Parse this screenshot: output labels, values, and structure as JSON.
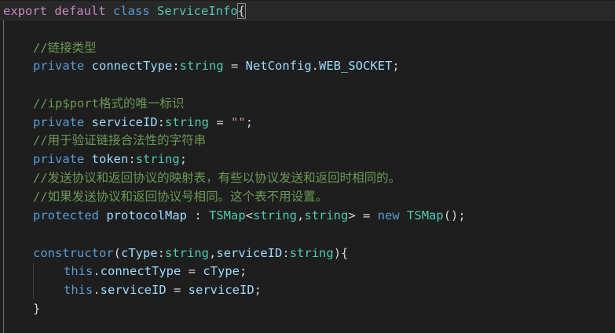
{
  "editor": {
    "theme_colors": {
      "background": "#1e1e1e",
      "keyword": "#569cd6",
      "keyword_control": "#c586c0",
      "type": "#4ec9b0",
      "variable": "#9cdcfe",
      "comment": "#6a9955",
      "string": "#ce9178",
      "plain": "#d4d4d4",
      "function": "#dcdcaa"
    },
    "lines": [
      {
        "tokens": [
          {
            "t": "export",
            "c": "keyword_control"
          },
          {
            "t": " ",
            "c": "plain"
          },
          {
            "t": "default",
            "c": "keyword_control"
          },
          {
            "t": " ",
            "c": "plain"
          },
          {
            "t": "class",
            "c": "keyword"
          },
          {
            "t": " ",
            "c": "plain"
          },
          {
            "t": "ServiceInfo",
            "c": "type"
          },
          {
            "t": "{",
            "c": "plain",
            "bracket": true
          }
        ]
      },
      {
        "tokens": []
      },
      {
        "tokens": [
          {
            "t": "//链接类型",
            "c": "comment"
          }
        ]
      },
      {
        "tokens": [
          {
            "t": "private",
            "c": "keyword"
          },
          {
            "t": " ",
            "c": "plain"
          },
          {
            "t": "connectType",
            "c": "variable"
          },
          {
            "t": ":",
            "c": "plain"
          },
          {
            "t": "string",
            "c": "type"
          },
          {
            "t": " = ",
            "c": "plain"
          },
          {
            "t": "NetConfig",
            "c": "variable"
          },
          {
            "t": ".",
            "c": "plain"
          },
          {
            "t": "WEB_SOCKET",
            "c": "variable"
          },
          {
            "t": ";",
            "c": "plain"
          }
        ]
      },
      {
        "tokens": []
      },
      {
        "tokens": [
          {
            "t": "//ip$port格式的唯一标识",
            "c": "comment"
          }
        ]
      },
      {
        "tokens": [
          {
            "t": "private",
            "c": "keyword"
          },
          {
            "t": " ",
            "c": "plain"
          },
          {
            "t": "serviceID",
            "c": "variable"
          },
          {
            "t": ":",
            "c": "plain"
          },
          {
            "t": "string",
            "c": "type"
          },
          {
            "t": " = ",
            "c": "plain"
          },
          {
            "t": "\"\"",
            "c": "string"
          },
          {
            "t": ";",
            "c": "plain"
          }
        ]
      },
      {
        "tokens": [
          {
            "t": "//用于验证链接合法性的字符串",
            "c": "comment"
          }
        ]
      },
      {
        "tokens": [
          {
            "t": "private",
            "c": "keyword"
          },
          {
            "t": " ",
            "c": "plain"
          },
          {
            "t": "token",
            "c": "variable"
          },
          {
            "t": ":",
            "c": "plain"
          },
          {
            "t": "string",
            "c": "type"
          },
          {
            "t": ";",
            "c": "plain"
          }
        ]
      },
      {
        "tokens": [
          {
            "t": "//发送协议和返回协议的映射表，有些以协议发送和返回时相同的。",
            "c": "comment"
          }
        ]
      },
      {
        "tokens": [
          {
            "t": "//如果发送协议和返回协议号相同。这个表不用设置。",
            "c": "comment"
          }
        ]
      },
      {
        "tokens": [
          {
            "t": "protected",
            "c": "keyword"
          },
          {
            "t": " ",
            "c": "plain"
          },
          {
            "t": "protocolMap",
            "c": "variable"
          },
          {
            "t": " : ",
            "c": "plain"
          },
          {
            "t": "TSMap",
            "c": "type"
          },
          {
            "t": "<",
            "c": "plain"
          },
          {
            "t": "string",
            "c": "type"
          },
          {
            "t": ",",
            "c": "plain"
          },
          {
            "t": "string",
            "c": "type"
          },
          {
            "t": "> = ",
            "c": "plain"
          },
          {
            "t": "new",
            "c": "keyword"
          },
          {
            "t": " ",
            "c": "plain"
          },
          {
            "t": "TSMap",
            "c": "type"
          },
          {
            "t": "();",
            "c": "plain"
          }
        ]
      },
      {
        "tokens": []
      },
      {
        "tokens": [
          {
            "t": "constructor",
            "c": "keyword"
          },
          {
            "t": "(",
            "c": "plain"
          },
          {
            "t": "cType",
            "c": "variable"
          },
          {
            "t": ":",
            "c": "plain"
          },
          {
            "t": "string",
            "c": "type"
          },
          {
            "t": ",",
            "c": "plain"
          },
          {
            "t": "serviceID",
            "c": "variable"
          },
          {
            "t": ":",
            "c": "plain"
          },
          {
            "t": "string",
            "c": "type"
          },
          {
            "t": "){",
            "c": "plain"
          }
        ]
      },
      {
        "tokens": [
          {
            "t": "this",
            "c": "keyword"
          },
          {
            "t": ".",
            "c": "plain"
          },
          {
            "t": "connectType",
            "c": "variable"
          },
          {
            "t": " = ",
            "c": "plain"
          },
          {
            "t": "cType",
            "c": "variable"
          },
          {
            "t": ";",
            "c": "plain"
          }
        ]
      },
      {
        "tokens": [
          {
            "t": "this",
            "c": "keyword"
          },
          {
            "t": ".",
            "c": "plain"
          },
          {
            "t": "serviceID",
            "c": "variable"
          },
          {
            "t": " = ",
            "c": "plain"
          },
          {
            "t": "serviceID",
            "c": "variable"
          },
          {
            "t": ";",
            "c": "plain"
          }
        ]
      },
      {
        "tokens": [
          {
            "t": "}",
            "c": "plain"
          }
        ]
      }
    ]
  }
}
